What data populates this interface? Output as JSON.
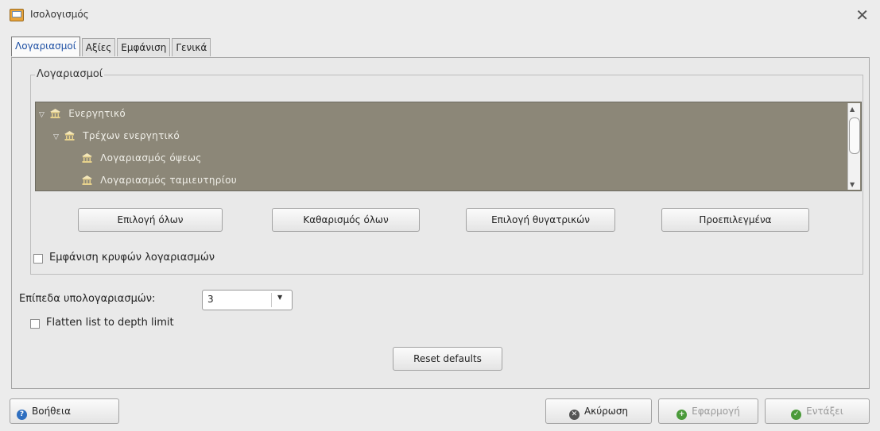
{
  "window": {
    "title": "Ισολογισμός"
  },
  "tabs": [
    {
      "label": "Λογαριασμοί",
      "active": true
    },
    {
      "label": "Αξίες",
      "active": false
    },
    {
      "label": "Εμφάνιση",
      "active": false
    },
    {
      "label": "Γενικά",
      "active": false
    }
  ],
  "accounts": {
    "frame_label": "Λογαριασμοί",
    "tree": [
      {
        "label": "Ενεργητικό",
        "level": 0,
        "expanded": true
      },
      {
        "label": "Τρέχων ενεργητικό",
        "level": 1,
        "expanded": true
      },
      {
        "label": "Λογαριασμός όψεως",
        "level": 2
      },
      {
        "label": "Λογαριασμός ταμιευτηρίου",
        "level": 2
      }
    ],
    "buttons": {
      "select_all": "Επιλογή όλων",
      "clear_all": "Καθαρισμός όλων",
      "select_children": "Επιλογή θυγατρικών",
      "defaults": "Προεπιλεγμένα"
    },
    "show_hidden_label": "Εμφάνιση κρυφών λογαριασμών",
    "show_hidden_checked": false
  },
  "subaccounts": {
    "levels_label": "Επίπεδα υπολογαριασμών:",
    "levels_value": "3",
    "flatten_label": "Flatten list to depth limit",
    "flatten_checked": false,
    "reset_label": "Reset defaults"
  },
  "footer": {
    "help": "Βοήθεια",
    "cancel": "Ακύρωση",
    "apply": "Εφαρμογή",
    "ok": "Εντάξει"
  },
  "colors": {
    "tree_bg": "#8c8778",
    "tab_active_text": "#1d4fa3",
    "help_icon": "#2f6fc0",
    "apply_icon": "#4a9a3a"
  }
}
